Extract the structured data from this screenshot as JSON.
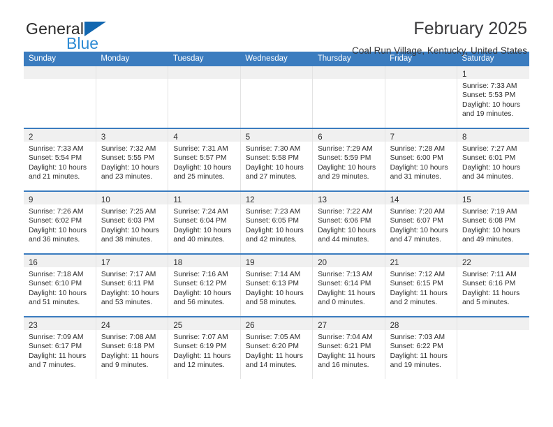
{
  "brand": {
    "word_one": "General",
    "word_two": "Blue",
    "triangle_color": "#1267b0",
    "blue_color": "#2e8bd4"
  },
  "header": {
    "title": "February 2025",
    "subtitle": "Coal Run Village, Kentucky, United States"
  },
  "theme": {
    "header_bg": "#3b7cbf",
    "daynum_band_bg": "#f0f0f0",
    "row_rule": "#3b7cbf"
  },
  "weekday_headers": [
    "Sunday",
    "Monday",
    "Tuesday",
    "Wednesday",
    "Thursday",
    "Friday",
    "Saturday"
  ],
  "weeks": [
    [
      {
        "day": "",
        "sunrise": "",
        "sunset": "",
        "daylight_1": "",
        "daylight_2": ""
      },
      {
        "day": "",
        "sunrise": "",
        "sunset": "",
        "daylight_1": "",
        "daylight_2": ""
      },
      {
        "day": "",
        "sunrise": "",
        "sunset": "",
        "daylight_1": "",
        "daylight_2": ""
      },
      {
        "day": "",
        "sunrise": "",
        "sunset": "",
        "daylight_1": "",
        "daylight_2": ""
      },
      {
        "day": "",
        "sunrise": "",
        "sunset": "",
        "daylight_1": "",
        "daylight_2": ""
      },
      {
        "day": "",
        "sunrise": "",
        "sunset": "",
        "daylight_1": "",
        "daylight_2": ""
      },
      {
        "day": "1",
        "sunrise": "Sunrise: 7:33 AM",
        "sunset": "Sunset: 5:53 PM",
        "daylight_1": "Daylight: 10 hours",
        "daylight_2": "and 19 minutes."
      }
    ],
    [
      {
        "day": "2",
        "sunrise": "Sunrise: 7:33 AM",
        "sunset": "Sunset: 5:54 PM",
        "daylight_1": "Daylight: 10 hours",
        "daylight_2": "and 21 minutes."
      },
      {
        "day": "3",
        "sunrise": "Sunrise: 7:32 AM",
        "sunset": "Sunset: 5:55 PM",
        "daylight_1": "Daylight: 10 hours",
        "daylight_2": "and 23 minutes."
      },
      {
        "day": "4",
        "sunrise": "Sunrise: 7:31 AM",
        "sunset": "Sunset: 5:57 PM",
        "daylight_1": "Daylight: 10 hours",
        "daylight_2": "and 25 minutes."
      },
      {
        "day": "5",
        "sunrise": "Sunrise: 7:30 AM",
        "sunset": "Sunset: 5:58 PM",
        "daylight_1": "Daylight: 10 hours",
        "daylight_2": "and 27 minutes."
      },
      {
        "day": "6",
        "sunrise": "Sunrise: 7:29 AM",
        "sunset": "Sunset: 5:59 PM",
        "daylight_1": "Daylight: 10 hours",
        "daylight_2": "and 29 minutes."
      },
      {
        "day": "7",
        "sunrise": "Sunrise: 7:28 AM",
        "sunset": "Sunset: 6:00 PM",
        "daylight_1": "Daylight: 10 hours",
        "daylight_2": "and 31 minutes."
      },
      {
        "day": "8",
        "sunrise": "Sunrise: 7:27 AM",
        "sunset": "Sunset: 6:01 PM",
        "daylight_1": "Daylight: 10 hours",
        "daylight_2": "and 34 minutes."
      }
    ],
    [
      {
        "day": "9",
        "sunrise": "Sunrise: 7:26 AM",
        "sunset": "Sunset: 6:02 PM",
        "daylight_1": "Daylight: 10 hours",
        "daylight_2": "and 36 minutes."
      },
      {
        "day": "10",
        "sunrise": "Sunrise: 7:25 AM",
        "sunset": "Sunset: 6:03 PM",
        "daylight_1": "Daylight: 10 hours",
        "daylight_2": "and 38 minutes."
      },
      {
        "day": "11",
        "sunrise": "Sunrise: 7:24 AM",
        "sunset": "Sunset: 6:04 PM",
        "daylight_1": "Daylight: 10 hours",
        "daylight_2": "and 40 minutes."
      },
      {
        "day": "12",
        "sunrise": "Sunrise: 7:23 AM",
        "sunset": "Sunset: 6:05 PM",
        "daylight_1": "Daylight: 10 hours",
        "daylight_2": "and 42 minutes."
      },
      {
        "day": "13",
        "sunrise": "Sunrise: 7:22 AM",
        "sunset": "Sunset: 6:06 PM",
        "daylight_1": "Daylight: 10 hours",
        "daylight_2": "and 44 minutes."
      },
      {
        "day": "14",
        "sunrise": "Sunrise: 7:20 AM",
        "sunset": "Sunset: 6:07 PM",
        "daylight_1": "Daylight: 10 hours",
        "daylight_2": "and 47 minutes."
      },
      {
        "day": "15",
        "sunrise": "Sunrise: 7:19 AM",
        "sunset": "Sunset: 6:08 PM",
        "daylight_1": "Daylight: 10 hours",
        "daylight_2": "and 49 minutes."
      }
    ],
    [
      {
        "day": "16",
        "sunrise": "Sunrise: 7:18 AM",
        "sunset": "Sunset: 6:10 PM",
        "daylight_1": "Daylight: 10 hours",
        "daylight_2": "and 51 minutes."
      },
      {
        "day": "17",
        "sunrise": "Sunrise: 7:17 AM",
        "sunset": "Sunset: 6:11 PM",
        "daylight_1": "Daylight: 10 hours",
        "daylight_2": "and 53 minutes."
      },
      {
        "day": "18",
        "sunrise": "Sunrise: 7:16 AM",
        "sunset": "Sunset: 6:12 PM",
        "daylight_1": "Daylight: 10 hours",
        "daylight_2": "and 56 minutes."
      },
      {
        "day": "19",
        "sunrise": "Sunrise: 7:14 AM",
        "sunset": "Sunset: 6:13 PM",
        "daylight_1": "Daylight: 10 hours",
        "daylight_2": "and 58 minutes."
      },
      {
        "day": "20",
        "sunrise": "Sunrise: 7:13 AM",
        "sunset": "Sunset: 6:14 PM",
        "daylight_1": "Daylight: 11 hours",
        "daylight_2": "and 0 minutes."
      },
      {
        "day": "21",
        "sunrise": "Sunrise: 7:12 AM",
        "sunset": "Sunset: 6:15 PM",
        "daylight_1": "Daylight: 11 hours",
        "daylight_2": "and 2 minutes."
      },
      {
        "day": "22",
        "sunrise": "Sunrise: 7:11 AM",
        "sunset": "Sunset: 6:16 PM",
        "daylight_1": "Daylight: 11 hours",
        "daylight_2": "and 5 minutes."
      }
    ],
    [
      {
        "day": "23",
        "sunrise": "Sunrise: 7:09 AM",
        "sunset": "Sunset: 6:17 PM",
        "daylight_1": "Daylight: 11 hours",
        "daylight_2": "and 7 minutes."
      },
      {
        "day": "24",
        "sunrise": "Sunrise: 7:08 AM",
        "sunset": "Sunset: 6:18 PM",
        "daylight_1": "Daylight: 11 hours",
        "daylight_2": "and 9 minutes."
      },
      {
        "day": "25",
        "sunrise": "Sunrise: 7:07 AM",
        "sunset": "Sunset: 6:19 PM",
        "daylight_1": "Daylight: 11 hours",
        "daylight_2": "and 12 minutes."
      },
      {
        "day": "26",
        "sunrise": "Sunrise: 7:05 AM",
        "sunset": "Sunset: 6:20 PM",
        "daylight_1": "Daylight: 11 hours",
        "daylight_2": "and 14 minutes."
      },
      {
        "day": "27",
        "sunrise": "Sunrise: 7:04 AM",
        "sunset": "Sunset: 6:21 PM",
        "daylight_1": "Daylight: 11 hours",
        "daylight_2": "and 16 minutes."
      },
      {
        "day": "28",
        "sunrise": "Sunrise: 7:03 AM",
        "sunset": "Sunset: 6:22 PM",
        "daylight_1": "Daylight: 11 hours",
        "daylight_2": "and 19 minutes."
      },
      {
        "day": "",
        "sunrise": "",
        "sunset": "",
        "daylight_1": "",
        "daylight_2": ""
      }
    ]
  ]
}
